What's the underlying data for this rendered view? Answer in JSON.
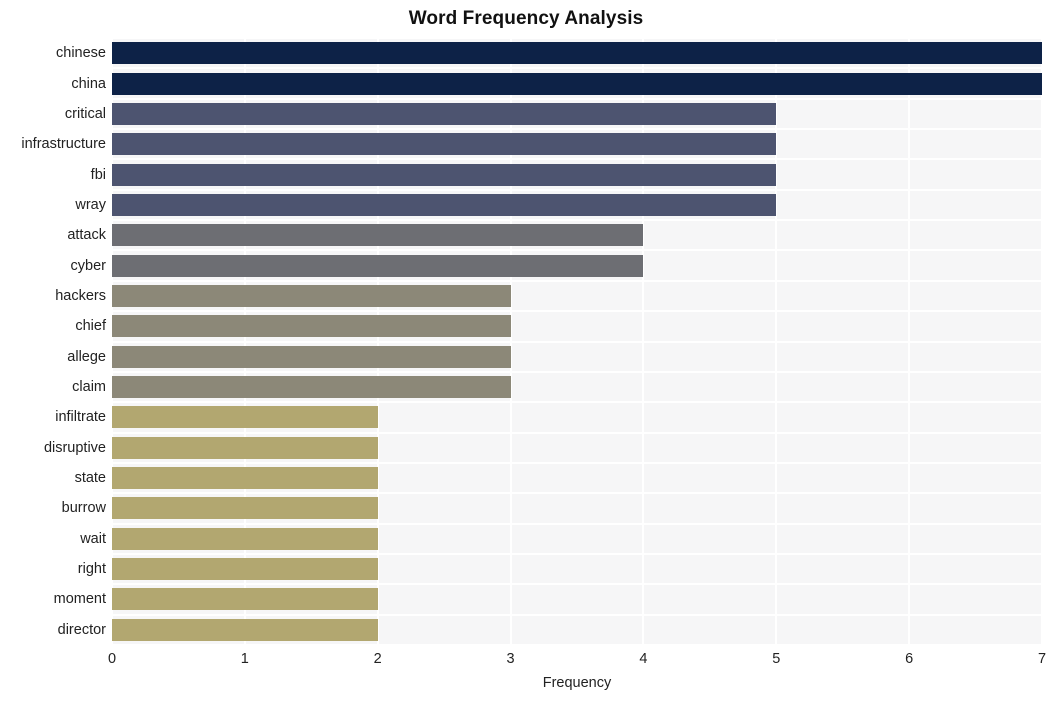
{
  "chart_data": {
    "type": "bar",
    "orientation": "horizontal",
    "title": "Word Frequency Analysis",
    "xlabel": "Frequency",
    "ylabel": "",
    "xlim": [
      0,
      7
    ],
    "xticks": [
      "0",
      "1",
      "2",
      "3",
      "4",
      "5",
      "6",
      "7"
    ],
    "grid": true,
    "legend": "none",
    "categories": [
      "chinese",
      "china",
      "critical",
      "infrastructure",
      "fbi",
      "wray",
      "attack",
      "cyber",
      "hackers",
      "chief",
      "allege",
      "claim",
      "infiltrate",
      "disruptive",
      "state",
      "burrow",
      "wait",
      "right",
      "moment",
      "director"
    ],
    "values": [
      7,
      7,
      5,
      5,
      5,
      5,
      4,
      4,
      3,
      3,
      3,
      3,
      2,
      2,
      2,
      2,
      2,
      2,
      2,
      2
    ],
    "bar_colors": [
      "#0d2247",
      "#0d2247",
      "#4d5470",
      "#4d5470",
      "#4d5470",
      "#4d5470",
      "#6d6e73",
      "#6d6e73",
      "#8c8878",
      "#8c8878",
      "#8c8878",
      "#8c8878",
      "#b2a770",
      "#b2a770",
      "#b2a770",
      "#b2a770",
      "#b2a770",
      "#b2a770",
      "#b2a770",
      "#b2a770"
    ]
  },
  "style": {
    "page_background": "#ffffff",
    "plot_background": "#f6f6f7",
    "gridline_color": "#ffffff",
    "text_color": "#222222",
    "title_color": "#111111"
  }
}
